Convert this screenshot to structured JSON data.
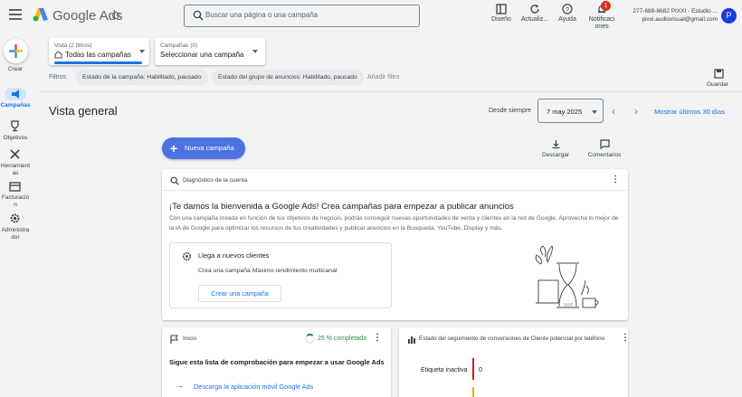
{
  "header": {
    "brand": "Google Ads",
    "search_placeholder": "Buscar una página o una campaña",
    "tools": [
      {
        "label": "Diseño",
        "icon": "layout-icon"
      },
      {
        "label": "Actualiz...",
        "icon": "refresh-icon"
      },
      {
        "label": "Ayuda",
        "icon": "help-icon"
      },
      {
        "label": "Notificaciones",
        "icon": "bell-icon"
      }
    ],
    "notification_count": "1",
    "account_line1": "277-688-8682 PIXXI - Estudio ...",
    "account_line2": "pixxi.audiovisual@gmail.com",
    "avatar_letter": "P"
  },
  "rail": {
    "create_label": "Crear",
    "items": [
      {
        "label": "Campañas",
        "icon": "megaphone-icon",
        "active": true
      },
      {
        "label": "Objetivos",
        "icon": "trophy-icon"
      },
      {
        "label": "Herramientas",
        "icon": "tools-icon"
      },
      {
        "label": "Facturación",
        "icon": "billing-icon"
      },
      {
        "label": "Administrador",
        "icon": "admin-gear-icon"
      }
    ]
  },
  "selectors": {
    "view_small": "Vista (2 filtros)",
    "view_main": "Todas las campañas",
    "campaign_small": "Campañas (0)",
    "campaign_main": "Seleccionar una campaña"
  },
  "filters": {
    "label": "Filtros",
    "chip1": "Estado de la campaña: Habilitado, pausado",
    "chip2": "Estado del grupo de anuncios: Habilitado, pausado",
    "add": "Añadir filtro",
    "save_label": "Guardar"
  },
  "overview": {
    "title": "Vista general",
    "since_label": "Desde siempre",
    "date_value": "7 may 2025",
    "show_last": "Mostrar últimos 30 días",
    "new_campaign": "Nueva campaña",
    "download": "Descargar",
    "comments": "Comentarios"
  },
  "diagnostic_card": {
    "header": "Diagnóstico de la cuenta",
    "title": "¡Te damos la bienvenida a Google Ads! Crea campañas para empezar a publicar anuncios",
    "body": "Con una campaña creada en función de tus objetivos de negocio, podrás conseguir nuevas oportunidades de venta y clientes en la red de Google. Aprovecha lo mejor de la IA de Google para optimizar los recursos de tus creatividades y publicar anuncios en la Búsqueda, YouTube, Display y más.",
    "inner_title": "Llega a nuevos clientes",
    "inner_sub": "Crea una campaña Máximo rendimiento multicanal",
    "inner_button": "Crear una campaña"
  },
  "start_card": {
    "header": "Inicio",
    "progress_label": "25 % completado",
    "progress": 0.25,
    "title": "Sigue esta lista de comprobación para empezar a usar Google Ads",
    "link": "Descarga la aplicación móvil Google Ads"
  },
  "conversion_card": {
    "header": "Estado del seguimiento de conversiones de Cliente potencial por teléfono",
    "row_label": "Etiqueta inactiva",
    "row_value": "0"
  },
  "colors": {
    "accent": "#1a73e8",
    "new_campaign": "#4c73e0",
    "badge": "#d93025",
    "progress": "#1e8e3e"
  }
}
